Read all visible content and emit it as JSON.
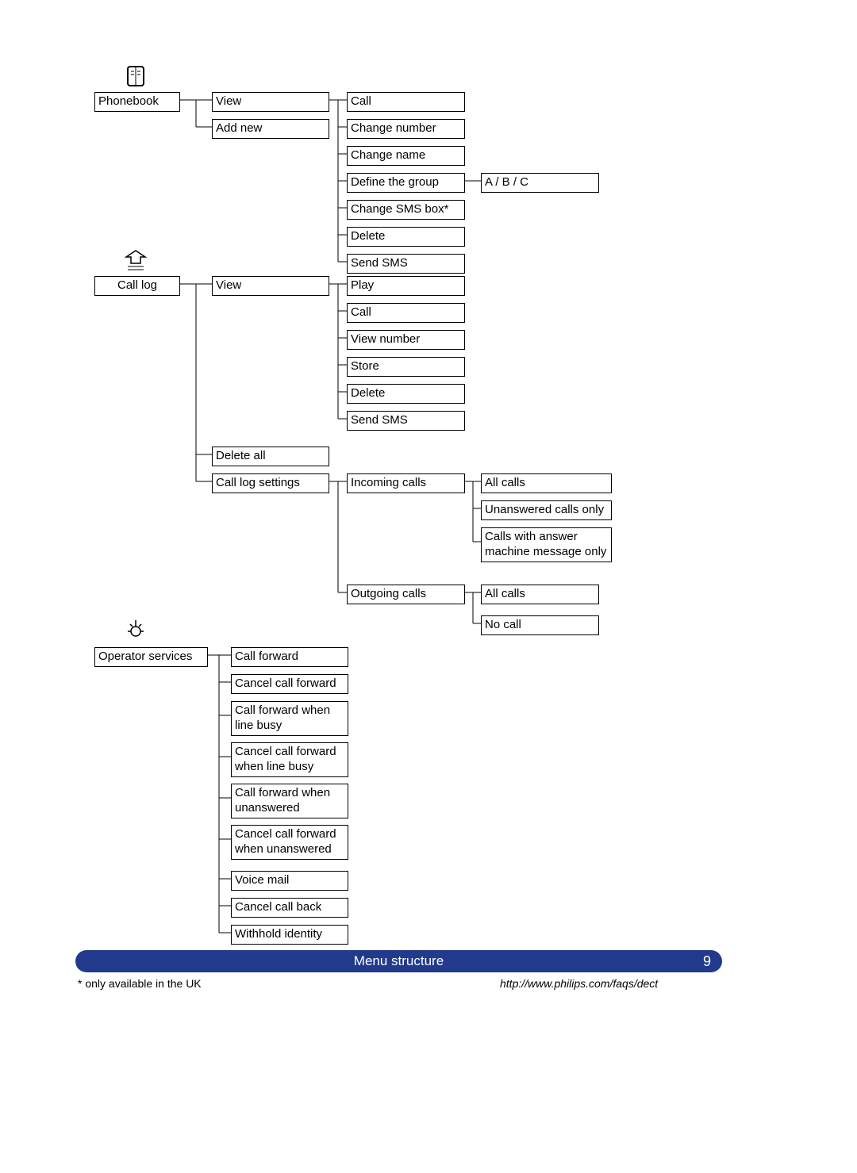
{
  "phonebook": {
    "label": "Phonebook",
    "items": {
      "view": "View",
      "addnew": "Add new"
    },
    "view_sub": {
      "call": "Call",
      "change_number": "Change number",
      "change_name": "Change name",
      "define_group": "Define the group",
      "group_opts": "A / B / C",
      "change_sms": "Change SMS box*",
      "delete": "Delete",
      "send_sms": "Send SMS"
    }
  },
  "calllog": {
    "label": "Call log",
    "items": {
      "view": "View",
      "delete_all": "Delete all",
      "settings": "Call log settings"
    },
    "view_sub": {
      "play": "Play",
      "call": "Call",
      "view_number": "View number",
      "store": "Store",
      "delete": "Delete",
      "send_sms": "Send SMS"
    },
    "settings_sub": {
      "incoming": "Incoming calls",
      "outgoing": "Outgoing calls",
      "incoming_opts": {
        "all": "All calls",
        "unanswered": "Unanswered calls only",
        "with_msg": "Calls with answer machine message only"
      },
      "outgoing_opts": {
        "all": "All calls",
        "none": "No call"
      }
    }
  },
  "opservices": {
    "label": "Operator services",
    "items": {
      "cf": "Call forward",
      "ccf": "Cancel call forward",
      "cf_busy": "Call forward when line busy",
      "ccf_busy": "Cancel call forward when line busy",
      "cf_unans": "Call forward when unanswered",
      "ccf_unans": "Cancel call forward when unanswered",
      "vm": "Voice mail",
      "ccb": "Cancel call back",
      "withhold": "Withhold identity"
    }
  },
  "footer": {
    "title": "Menu structure",
    "page": "9",
    "footnote": "*  only available in the UK",
    "url": "http://www.philips.com/faqs/dect"
  }
}
